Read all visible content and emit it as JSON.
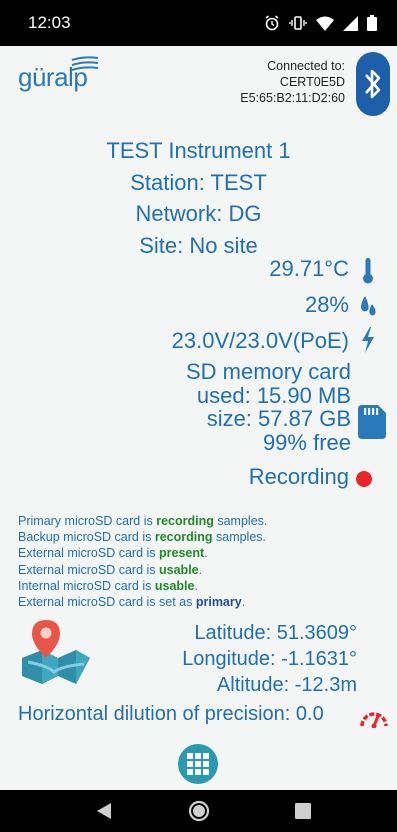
{
  "status_bar": {
    "time": "12:03"
  },
  "header": {
    "brand": "güralp",
    "connection_label": "Connected to:",
    "device_name": "CERT0E5D",
    "mac_address": "E5:65:B2:11:D2:60"
  },
  "instrument": {
    "name": "TEST Instrument 1",
    "station": "Station: TEST",
    "network": "Network: DG",
    "site": "Site: No site"
  },
  "readings": {
    "temperature": "29.71°C",
    "humidity": "28%",
    "voltage": "23.0V/23.0V(PoE)"
  },
  "sd_card": {
    "title": "SD memory card",
    "used": "used: 15.90 MB",
    "size": "size: 57.87 GB",
    "free": "99% free"
  },
  "recording": {
    "label": "Recording"
  },
  "messages": {
    "primary": {
      "pre": "Primary microSD card is ",
      "em": "recording",
      "post": " samples."
    },
    "backup": {
      "pre": "Backup microSD card is ",
      "em": "recording",
      "post": " samples."
    },
    "external_present": {
      "pre": "External microSD card is ",
      "em": "present",
      "post": "."
    },
    "external_usable": {
      "pre": "External microSD card is ",
      "em": "usable",
      "post": "."
    },
    "internal_usable": {
      "pre": "Internal microSD card is ",
      "em": "usable",
      "post": "."
    },
    "external_primary": {
      "pre": "External microSD card is set as ",
      "em": "primary",
      "post": "."
    }
  },
  "location": {
    "latitude": "Latitude: 51.3609°",
    "longitude": "Longitude: -1.1631°",
    "altitude": "Altitude: -12.3m",
    "hdop": "Horizontal dilution of precision: 0.0"
  },
  "colors": {
    "accent_blue": "#1f6fb2",
    "bluetooth_blue": "#1d5fa8",
    "recording_red": "#e8262b",
    "status_green": "#1f8a2a",
    "grid_button_teal": "#2a9ab0"
  },
  "icons": [
    "alarm-icon",
    "vibrate-icon",
    "wifi-icon",
    "signal-icon",
    "battery-icon",
    "bluetooth-icon",
    "thermometer-icon",
    "humidity-icon",
    "power-icon",
    "sd-card-icon",
    "record-dot-icon",
    "map-pin-icon",
    "gauge-icon",
    "grid-menu-icon",
    "back-icon",
    "home-icon",
    "recents-icon"
  ]
}
